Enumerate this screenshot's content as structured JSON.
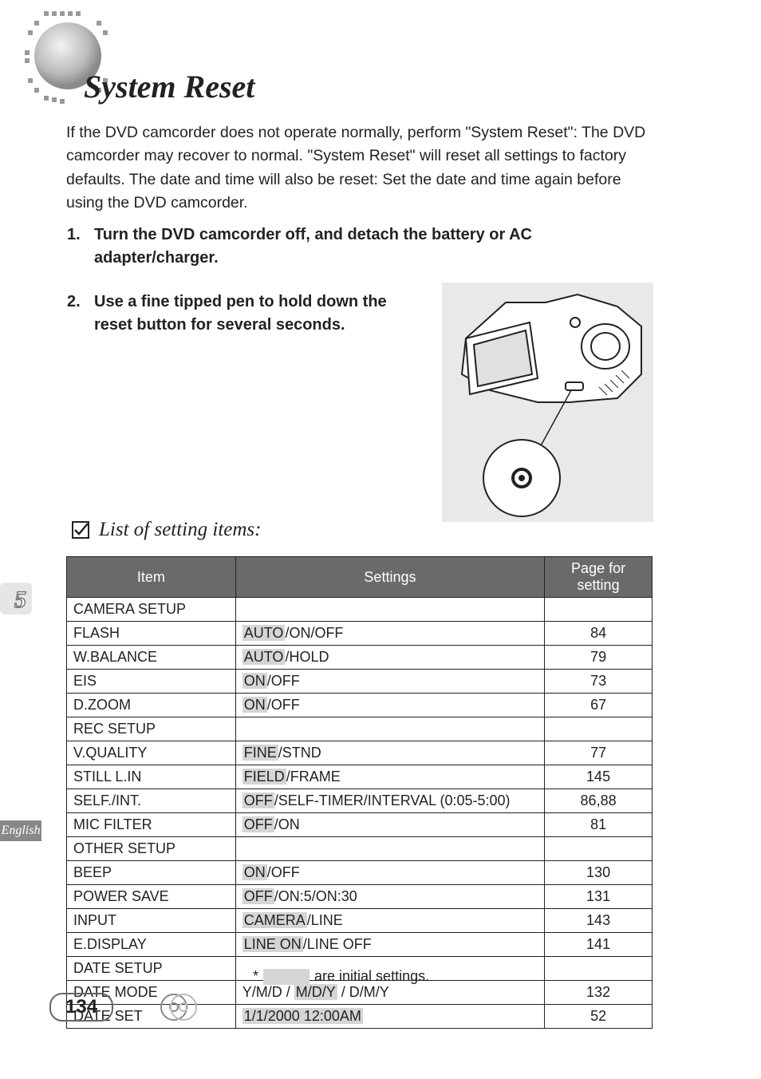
{
  "heading": "System Reset",
  "intro": "If the DVD camcorder does not operate normally, perform \"System Reset\": The DVD camcorder may recover to normal. \"System Reset\" will reset all settings to factory defaults. The date and time will also be reset: Set the date and time again before using the DVD camcorder.",
  "steps": {
    "s1_num": "1.",
    "s1_text": "Turn the DVD camcorder off, and detach the battery or AC adapter/charger.",
    "s2_num": "2.",
    "s2_text": "Use a fine tipped pen to hold down the reset button for several seconds."
  },
  "subheading": "List of setting items:",
  "table": {
    "headers": {
      "item": "Item",
      "settings": "Settings",
      "page": "Page for setting"
    },
    "rows": [
      {
        "type": "cat",
        "item": "CAMERA SETUP",
        "settings_parts": [],
        "page": ""
      },
      {
        "type": "sub",
        "item": "FLASH",
        "settings_parts": [
          {
            "t": "AUTO",
            "hl": true
          },
          {
            "t": "/ON/OFF"
          }
        ],
        "page": "84"
      },
      {
        "type": "sub",
        "item": "W.BALANCE",
        "settings_parts": [
          {
            "t": "AUTO",
            "hl": true
          },
          {
            "t": "/HOLD"
          }
        ],
        "page": "79"
      },
      {
        "type": "sub",
        "item": "EIS",
        "settings_parts": [
          {
            "t": "ON",
            "hl": true
          },
          {
            "t": "/OFF"
          }
        ],
        "page": "73"
      },
      {
        "type": "sub",
        "item": "D.ZOOM",
        "settings_parts": [
          {
            "t": "ON",
            "hl": true
          },
          {
            "t": "/OFF"
          }
        ],
        "page": "67"
      },
      {
        "type": "cat",
        "item": "REC SETUP",
        "settings_parts": [],
        "page": ""
      },
      {
        "type": "sub",
        "item": "V.QUALITY",
        "settings_parts": [
          {
            "t": "FINE",
            "hl": true
          },
          {
            "t": "/STND"
          }
        ],
        "page": "77"
      },
      {
        "type": "sub",
        "item": "STILL L.IN",
        "settings_parts": [
          {
            "t": "FIELD",
            "hl": true
          },
          {
            "t": "/FRAME"
          }
        ],
        "page": "145"
      },
      {
        "type": "sub",
        "item": "SELF./INT.",
        "settings_parts": [
          {
            "t": "OFF",
            "hl": true
          },
          {
            "t": "/SELF-TIMER/INTERVAL (0:05-5:00)"
          }
        ],
        "page": "86,88"
      },
      {
        "type": "sub",
        "item": "MIC FILTER",
        "settings_parts": [
          {
            "t": "OFF",
            "hl": true
          },
          {
            "t": "/ON"
          }
        ],
        "page": "81"
      },
      {
        "type": "cat",
        "item": "OTHER SETUP",
        "settings_parts": [],
        "page": ""
      },
      {
        "type": "sub",
        "item": "BEEP",
        "settings_parts": [
          {
            "t": "ON",
            "hl": true
          },
          {
            "t": "/OFF"
          }
        ],
        "page": "130"
      },
      {
        "type": "sub",
        "item": "POWER SAVE",
        "settings_parts": [
          {
            "t": "OFF",
            "hl": true
          },
          {
            "t": "/ON:5/ON:30"
          }
        ],
        "page": "131"
      },
      {
        "type": "sub",
        "item": "INPUT",
        "settings_parts": [
          {
            "t": "CAMERA",
            "hl": true
          },
          {
            "t": "/LINE"
          }
        ],
        "page": "143"
      },
      {
        "type": "sub",
        "item": "E.DISPLAY",
        "settings_parts": [
          {
            "t": "LINE ON",
            "hl": true
          },
          {
            "t": "/LINE OFF"
          }
        ],
        "page": "141"
      },
      {
        "type": "cat",
        "item": "DATE SETUP",
        "settings_parts": [],
        "page": ""
      },
      {
        "type": "sub",
        "item": "DATE MODE",
        "settings_parts": [
          {
            "t": "Y/M/D / "
          },
          {
            "t": "M/D/Y",
            "hl": true
          },
          {
            "t": " / D/M/Y"
          }
        ],
        "page": "132"
      },
      {
        "type": "sub",
        "item": "DATE SET",
        "settings_parts": [
          {
            "t": "1/1/2000 12:00AM",
            "hl": true
          }
        ],
        "page": "52"
      }
    ]
  },
  "footnote": {
    "star": "*",
    "tail": "are initial settings."
  },
  "sidebar": {
    "chapter": "5",
    "language": "English",
    "page_number": "134"
  }
}
